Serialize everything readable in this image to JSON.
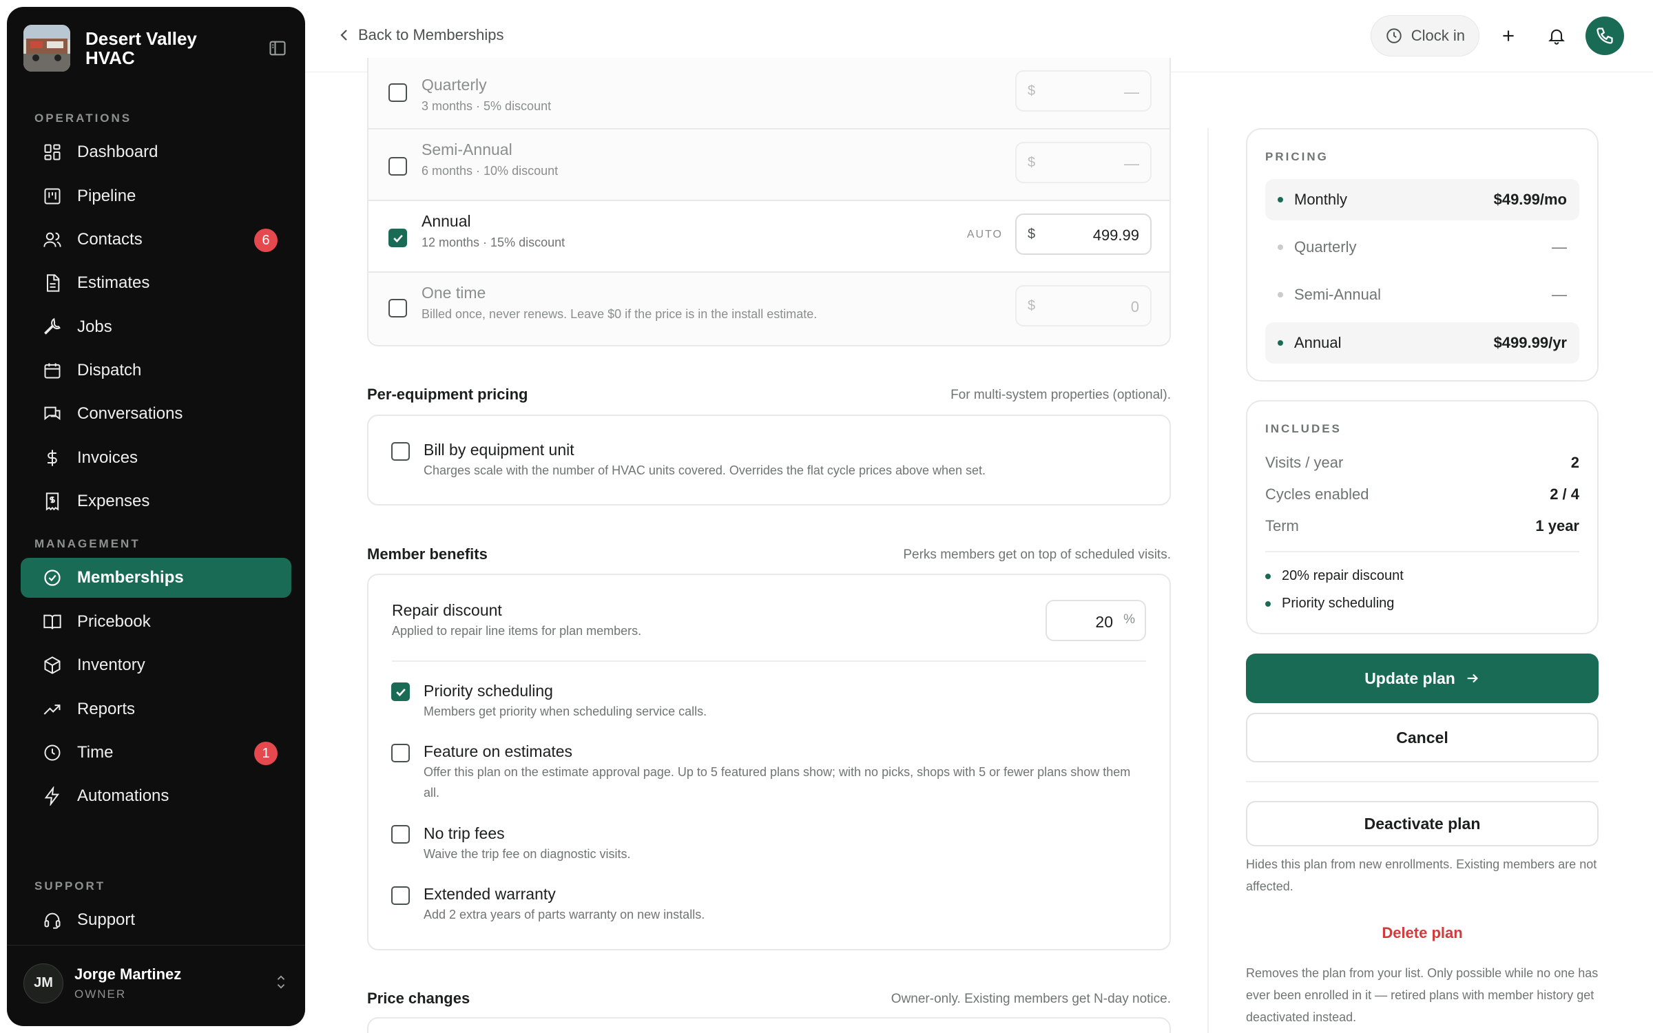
{
  "sidebar": {
    "brand": {
      "name": "Desert Valley HVAC"
    },
    "sections": {
      "operations": "OPERATIONS",
      "management": "MANAGEMENT",
      "support": "SUPPORT"
    },
    "items": [
      {
        "label": "Dashboard",
        "icon": "dashboard-icon"
      },
      {
        "label": "Pipeline",
        "icon": "pipeline-icon"
      },
      {
        "label": "Contacts",
        "icon": "contacts-icon",
        "badge": "6"
      },
      {
        "label": "Estimates",
        "icon": "estimates-icon"
      },
      {
        "label": "Jobs",
        "icon": "wrench-icon"
      },
      {
        "label": "Dispatch",
        "icon": "calendar-icon"
      },
      {
        "label": "Conversations",
        "icon": "chat-icon"
      },
      {
        "label": "Invoices",
        "icon": "dollar-icon"
      },
      {
        "label": "Expenses",
        "icon": "receipt-icon"
      },
      {
        "label": "Memberships",
        "icon": "badge-check-icon",
        "active": true
      },
      {
        "label": "Pricebook",
        "icon": "book-icon"
      },
      {
        "label": "Inventory",
        "icon": "box-icon"
      },
      {
        "label": "Reports",
        "icon": "trend-icon"
      },
      {
        "label": "Time",
        "icon": "clock-icon",
        "badge": "1"
      },
      {
        "label": "Automations",
        "icon": "bolt-icon"
      },
      {
        "label": "Support",
        "icon": "headset-icon"
      }
    ],
    "user": {
      "initials": "JM",
      "name": "Jorge Martinez",
      "role": "OWNER"
    }
  },
  "topbar": {
    "back_label": "Back to Memberships",
    "clock_label": "Clock in"
  },
  "billing_cycles": [
    {
      "title": "Quarterly",
      "sub": "3 months · 5% discount",
      "currency": "$",
      "value": "—",
      "checked": false
    },
    {
      "title": "Semi-Annual",
      "sub": "6 months · 10% discount",
      "currency": "$",
      "value": "—",
      "checked": false
    },
    {
      "title": "Annual",
      "sub": "12 months · 15% discount",
      "currency": "$",
      "value": "499.99",
      "checked": true,
      "tag": "AUTO"
    },
    {
      "title": "One time",
      "sub": "Billed once, never renews. Leave $0 if the price is in the install estimate.",
      "currency": "$",
      "value": "0",
      "checked": false
    }
  ],
  "per_equipment": {
    "heading": "Per-equipment pricing",
    "hint": "For multi-system properties (optional).",
    "option_title": "Bill by equipment unit",
    "option_sub": "Charges scale with the number of HVAC units covered. Overrides the flat cycle prices above when set."
  },
  "benefits": {
    "heading": "Member benefits",
    "hint": "Perks members get on top of scheduled visits.",
    "repair_title": "Repair discount",
    "repair_sub": "Applied to repair line items for plan members.",
    "repair_value": "20",
    "repair_unit": "%",
    "options": [
      {
        "title": "Priority scheduling",
        "sub": "Members get priority when scheduling service calls.",
        "checked": true
      },
      {
        "title": "Feature on estimates",
        "sub": "Offer this plan on the estimate approval page. Up to 5 featured plans show; with no picks, shops with 5 or fewer plans show them all.",
        "checked": false
      },
      {
        "title": "No trip fees",
        "sub": "Waive the trip fee on diagnostic visits.",
        "checked": false
      },
      {
        "title": "Extended warranty",
        "sub": "Add 2 extra years of parts warranty on new installs.",
        "checked": false
      }
    ]
  },
  "price_changes": {
    "heading": "Price changes",
    "hint": "Owner-only. Existing members get N-day notice."
  },
  "pricing_panel": {
    "label": "PRICING",
    "rows": [
      {
        "name": "Monthly",
        "amount": "$49.99/mo",
        "active": true
      },
      {
        "name": "Quarterly",
        "amount": "—",
        "active": false
      },
      {
        "name": "Semi-Annual",
        "amount": "—",
        "active": false
      },
      {
        "name": "Annual",
        "amount": "$499.99/yr",
        "active": true
      }
    ]
  },
  "includes_panel": {
    "label": "INCLUDES",
    "rows": [
      {
        "k": "Visits / year",
        "v": "2"
      },
      {
        "k": "Cycles enabled",
        "v": "2 / 4"
      },
      {
        "k": "Term",
        "v": "1 year"
      }
    ],
    "bullets": [
      "20% repair discount",
      "Priority scheduling"
    ]
  },
  "actions": {
    "update_label": "Update plan",
    "cancel_label": "Cancel",
    "deactivate_label": "Deactivate plan",
    "deactivate_note": "Hides this plan from new enrollments. Existing members are not affected.",
    "delete_label": "Delete plan",
    "delete_note": "Removes the plan from your list. Only possible while no one has ever been enrolled in it — retired plans with member history get deactivated instead."
  },
  "colors": {
    "accent": "#1a6b55",
    "danger": "#d13b3b",
    "badge": "#e5484d",
    "sidebar_bg": "#0d0e0d"
  }
}
